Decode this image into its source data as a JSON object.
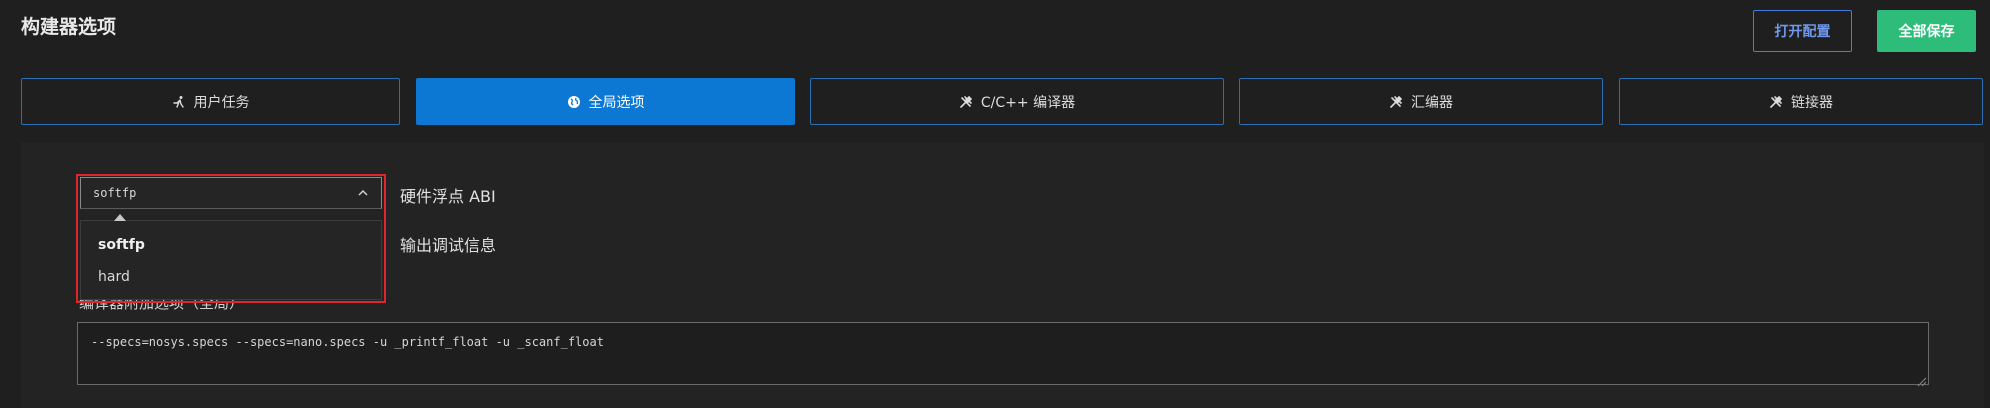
{
  "header": {
    "title": "构建器选项",
    "open_config_label": "打开配置",
    "save_all_label": "全部保存"
  },
  "tabs": [
    {
      "label": "用户任务",
      "icon": "run-icon",
      "active": false
    },
    {
      "label": "全局选项",
      "icon": "globe-icon",
      "active": true
    },
    {
      "label": "C/C++ 编译器",
      "icon": "tools-icon",
      "active": false
    },
    {
      "label": "汇编器",
      "icon": "tools-icon",
      "active": false
    },
    {
      "label": "链接器",
      "icon": "tools-icon",
      "active": false
    }
  ],
  "global_options": {
    "float_abi": {
      "value": "softfp",
      "label": "硬件浮点 ABI",
      "options": [
        "softfp",
        "hard"
      ]
    },
    "debug_info_label": "输出调试信息",
    "compiler_extra": {
      "label": "编译器附加选项（全局）",
      "value": "--specs=nosys.specs --specs=nano.specs -u _printf_float -u _scanf_float"
    }
  },
  "colors": {
    "accent": "#0c78d4",
    "save": "#2dbc7a",
    "highlight": "#e0262c"
  }
}
